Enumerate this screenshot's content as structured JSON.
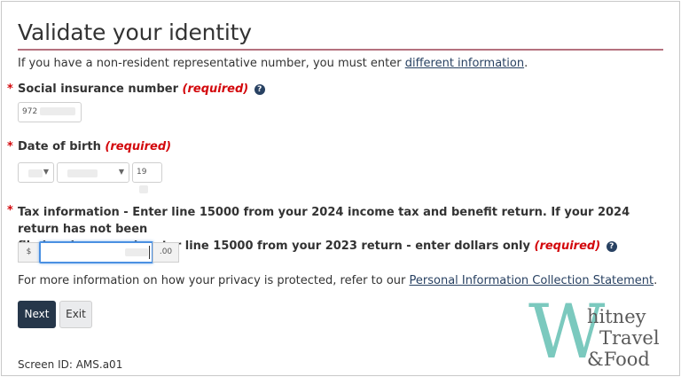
{
  "page": {
    "title": "Validate your identity",
    "intro_text": "If you have a non-resident representative number, you must enter",
    "intro_link": "different information",
    "intro_end": "."
  },
  "sin": {
    "star": "*",
    "label": "Social insurance number",
    "required": "(required)",
    "help_icon": "?",
    "value": "972"
  },
  "dob": {
    "star": "*",
    "label": "Date of birth",
    "required": "(required)",
    "year_prefix": "19"
  },
  "tax": {
    "star": "*",
    "label_line1": "Tax information - Enter line 15000 from your 2024 income tax and benefit return. If your 2024 return has not been",
    "label_line2": "filed and assessed, enter line 15000 from your 2023 return - enter dollars only",
    "required": "(required)",
    "help_icon": "?",
    "currency_prefix": "$",
    "cents_suffix": ".00"
  },
  "privacy": {
    "text": "For more information on how your privacy is protected, refer to our",
    "link": "Personal Information Collection Statement",
    "end": "."
  },
  "buttons": {
    "next": "Next",
    "exit": "Exit"
  },
  "footer": {
    "screen_id": "Screen ID: AMS.a01"
  },
  "watermark": {
    "letter": "W",
    "line1": "hitney",
    "line2": "Travel",
    "line3": "&Food"
  },
  "colors": {
    "title_rule": "#b5727e",
    "required": "#d3080c",
    "link": "#284162",
    "next_button": "#26374a",
    "focus_border": "#4a90e2",
    "watermark_letter": "#7bc9be"
  }
}
